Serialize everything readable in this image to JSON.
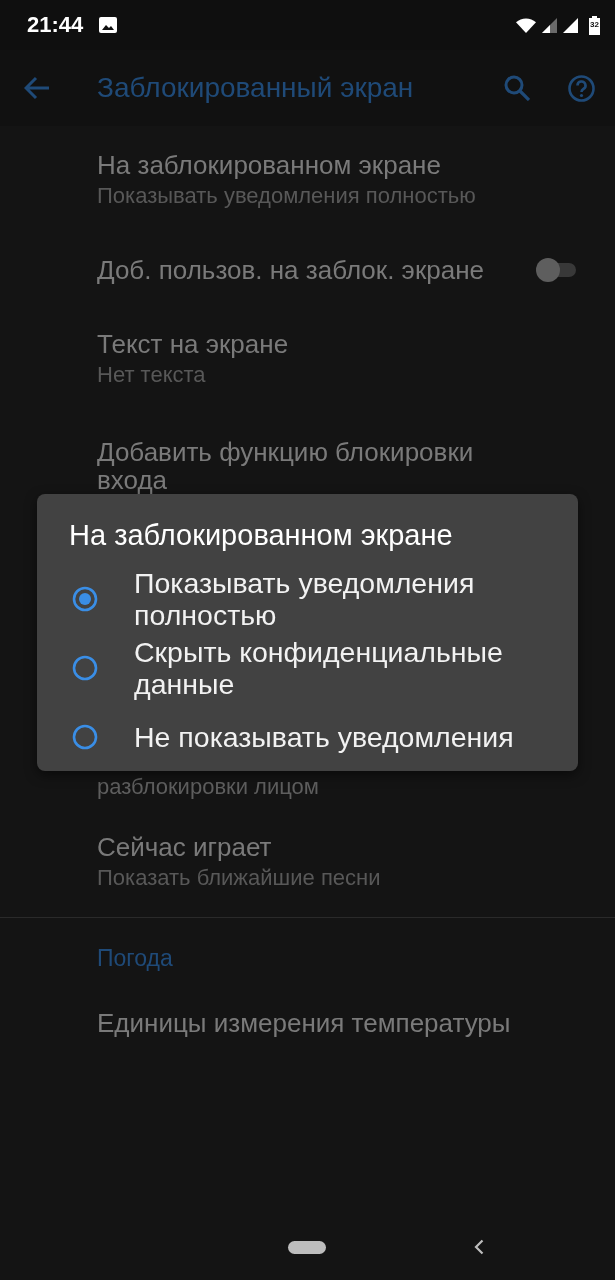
{
  "status_bar": {
    "time": "21:44",
    "battery": "32"
  },
  "app_bar": {
    "title": "Заблокированный экран"
  },
  "settings": [
    {
      "kind": "detail",
      "title": "На заблокированном экране",
      "summary": "Показывать уведомления полностью"
    },
    {
      "kind": "switch",
      "title": "Доб. пользов. на заблок. экране",
      "on": false
    },
    {
      "kind": "detail",
      "title": "Текст на экране",
      "summary": "Нет текста"
    },
    {
      "kind": "plain",
      "title": "Добавить функцию блокировки входа"
    },
    {
      "kind": "covered",
      "summary": "разблокировки лицом"
    },
    {
      "kind": "detail",
      "title": "Сейчас играет",
      "summary": "Показать ближайшие песни"
    }
  ],
  "sections": [
    {
      "header": "Погода",
      "items": [
        {
          "title": "Единицы измерения температуры"
        }
      ]
    }
  ],
  "dialog": {
    "title": "На заблокированном экране",
    "options": [
      {
        "label": "Показывать уведомления полностью",
        "selected": true
      },
      {
        "label": "Скрыть конфиденциальные данные",
        "selected": false
      },
      {
        "label": "Не показывать уведомления",
        "selected": false
      }
    ]
  }
}
